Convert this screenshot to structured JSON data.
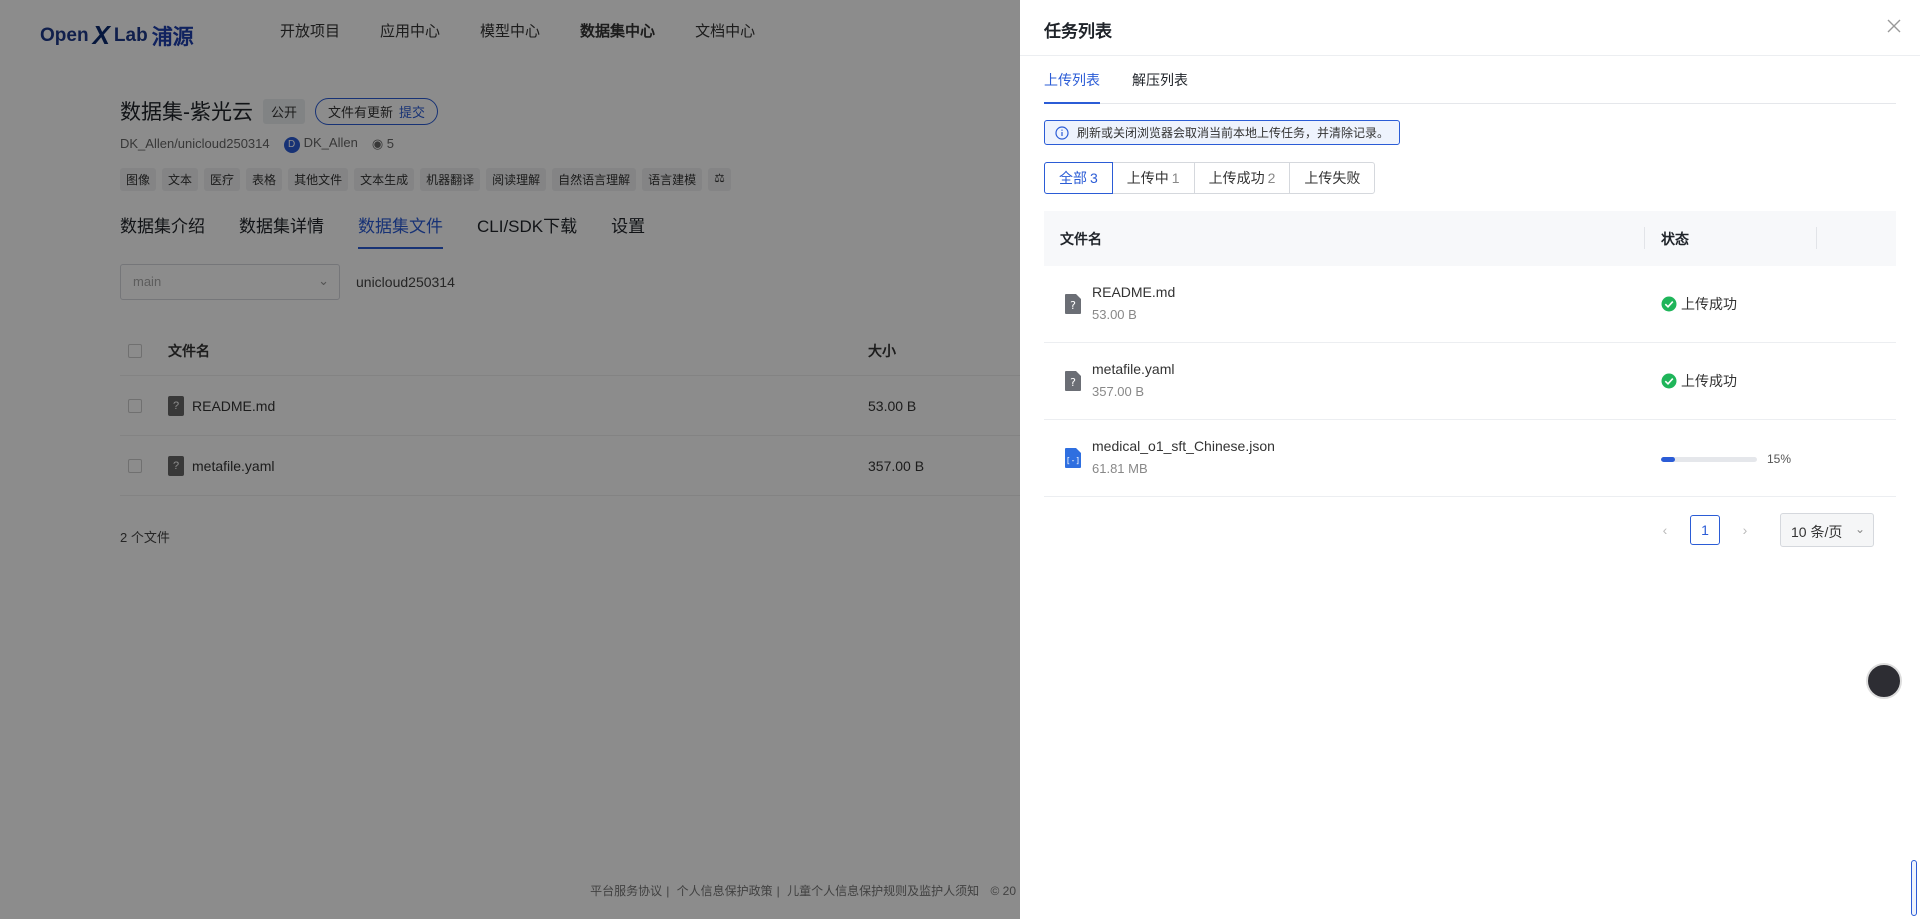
{
  "background": {
    "logo": {
      "open": "Open",
      "x": "X",
      "lab": "Lab",
      "cn": "浦源"
    },
    "nav": [
      "开放项目",
      "应用中心",
      "模型中心",
      "数据集中心",
      "文档中心"
    ],
    "dataset": {
      "title": "数据集-紫光云",
      "visibility": "公开",
      "update_notice": "文件有更新",
      "submit_link": "提交",
      "path": "DK_Allen/unicloud250314",
      "owner_initial": "D",
      "owner": "DK_Allen",
      "views": "5",
      "tags": [
        "图像",
        "文本",
        "医疗",
        "表格",
        "其他文件",
        "文本生成",
        "机器翻译",
        "阅读理解",
        "自然语言理解",
        "语言建模",
        "⚖"
      ],
      "tabs": [
        "数据集介绍",
        "数据集详情",
        "数据集文件",
        "CLI/SDK下载",
        "设置"
      ],
      "branch_placeholder": "main",
      "branch_name": "unicloud250314",
      "table_headers": {
        "name": "文件名",
        "size": "大小"
      },
      "files": [
        {
          "name": "README.md",
          "size": "53.00 B"
        },
        {
          "name": "metafile.yaml",
          "size": "357.00 B"
        }
      ],
      "file_count": "2 个文件"
    },
    "footer": [
      "平台服务协议",
      "个人信息保护政策",
      "儿童个人信息保护规则及监护人须知",
      "© 20"
    ]
  },
  "drawer": {
    "title": "任务列表",
    "tabs": [
      "上传列表",
      "解压列表"
    ],
    "notice": "刷新或关闭浏览器会取消当前本地上传任务，并清除记录。",
    "filters": [
      {
        "label": "全部",
        "count": "3"
      },
      {
        "label": "上传中",
        "count": "1"
      },
      {
        "label": "上传成功",
        "count": "2"
      },
      {
        "label": "上传失败",
        "count": ""
      }
    ],
    "table_headers": {
      "name": "文件名",
      "status": "状态"
    },
    "tasks": [
      {
        "name": "README.md",
        "size": "53.00 B",
        "status": "上传成功",
        "icon": "unknown-file-icon"
      },
      {
        "name": "metafile.yaml",
        "size": "357.00 B",
        "status": "上传成功",
        "icon": "unknown-file-icon"
      },
      {
        "name": "medical_o1_sft_Chinese.json",
        "size": "61.81 MB",
        "progress_label": "15%",
        "progress": 0.15,
        "icon": "json-file-icon"
      }
    ],
    "pagination": {
      "prev": "‹",
      "page": "1",
      "next": "›",
      "page_size": "10 条/页"
    }
  },
  "colors": {
    "accent": "#2b5cd6",
    "success": "#1fb55a",
    "overlay": "rgba(0,0,0,0.45)"
  }
}
